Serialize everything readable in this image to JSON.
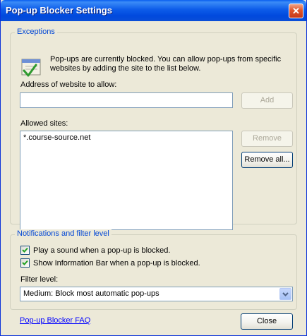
{
  "window": {
    "title": "Pop-up Blocker Settings",
    "close_glyph": "✕"
  },
  "exceptions": {
    "legend": "Exceptions",
    "icon": "shield-checkmark-icon",
    "info": "Pop-ups are currently blocked.  You can allow pop-ups from specific websites by adding the site to the list below.",
    "address_label": "Address of website to allow:",
    "address_value": "",
    "add_label": "Add",
    "allowed_label": "Allowed sites:",
    "allowed_sites": [
      "*.course-source.net"
    ],
    "remove_label": "Remove",
    "remove_all_label": "Remove all..."
  },
  "notifications": {
    "legend": "Notifications and filter level",
    "play_sound_label": "Play a sound when a pop-up is blocked.",
    "play_sound_checked": true,
    "info_bar_label": "Show Information Bar when a pop-up is blocked.",
    "info_bar_checked": true,
    "filter_label": "Filter level:",
    "filter_value": "Medium: Block most automatic pop-ups"
  },
  "footer": {
    "faq_link": "Pop-up Blocker FAQ",
    "close_label": "Close"
  },
  "colors": {
    "title_bar": "#0054e3",
    "legend_text": "#0046d5",
    "link": "#0000ff",
    "dialog_bg": "#ece9d8"
  }
}
